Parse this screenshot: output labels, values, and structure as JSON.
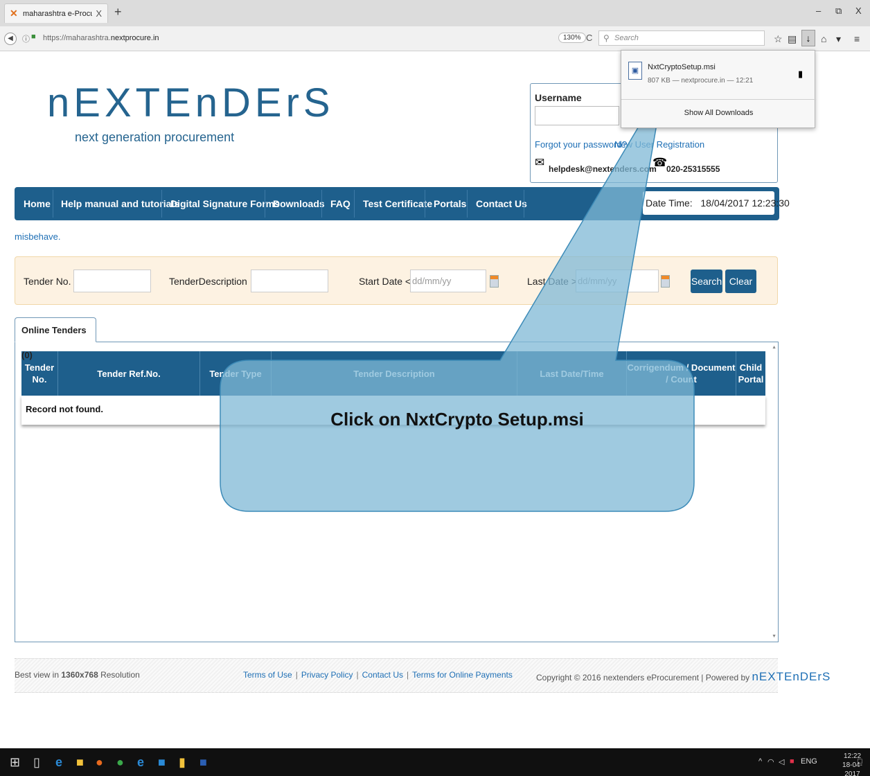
{
  "browser": {
    "tab_title": "maharashtra e-Procureme...",
    "tab_close": "X",
    "new_tab": "+",
    "url_prefix": "https://maharashtra.",
    "url_domain": "nextprocure.in",
    "zoom": "130%",
    "search_placeholder": "Search",
    "window_minimize": "–",
    "window_restore": "⧉",
    "window_close": "X"
  },
  "downloads": {
    "file_name": "NxtCryptoSetup.msi",
    "file_meta": "807 KB — nextprocure.in — 12:21",
    "show_all": "Show All Downloads"
  },
  "header": {
    "logo": "nEXTEnDErS",
    "tagline": "next generation procurement"
  },
  "login": {
    "username_label": "Username",
    "forgot": "Forgot your password?",
    "new_user": "New User Registration",
    "email": "helpdesk@nextenders.com",
    "phone": "020-25315555"
  },
  "menu": {
    "items": [
      "Home",
      "Help manual and tutorials",
      "Digital Signature Forms",
      "Downloads",
      "FAQ",
      "Test Certificate",
      "Portals",
      "Contact Us"
    ],
    "datetime_label": "Date Time:",
    "datetime_value": "18/04/2017 12:23:30"
  },
  "marquee": "misbehave.",
  "search": {
    "tender_no_label": "Tender No.",
    "desc_label": "TenderDescription",
    "start_date_label": "Start Date <=",
    "start_date_placeholder": "dd/mm/yy",
    "last_date_label": "Last Date >=",
    "last_date_placeholder": "dd/mm/yy",
    "search_button": "Search",
    "clear_button": "Clear"
  },
  "tenders": {
    "tab_label": "Online Tenders (0)",
    "columns": [
      "Tender No.",
      "Tender Ref.No.",
      "Tender Type",
      "Tender Description",
      "Last Date/Time",
      "Corrigendum / Document / Count",
      "Child Portal"
    ],
    "empty_message": "Record not found."
  },
  "footer": {
    "best_view_prefix": "Best view in ",
    "best_view_res": "1360x768",
    "best_view_suffix": " Resolution",
    "links": [
      "Terms of Use",
      "Privacy Policy",
      "Contact Us",
      "Terms for Online Payments"
    ],
    "copyright": "Copyright © 2016 nextenders eProcurement | Powered by ",
    "powered_logo": "nEXTEnDErS"
  },
  "callout": {
    "text": "Click on NxtCrypto Setup.msi",
    "fill": "#7fb8d6",
    "stroke": "#3d8bb8"
  },
  "taskbar": {
    "language": "ENG",
    "time": "12:22",
    "date": "18-04-2017"
  },
  "colors": {
    "brand_blue": "#1e5f8c",
    "link_blue": "#1e6fb5",
    "panel_beige": "#fdf2e2"
  }
}
